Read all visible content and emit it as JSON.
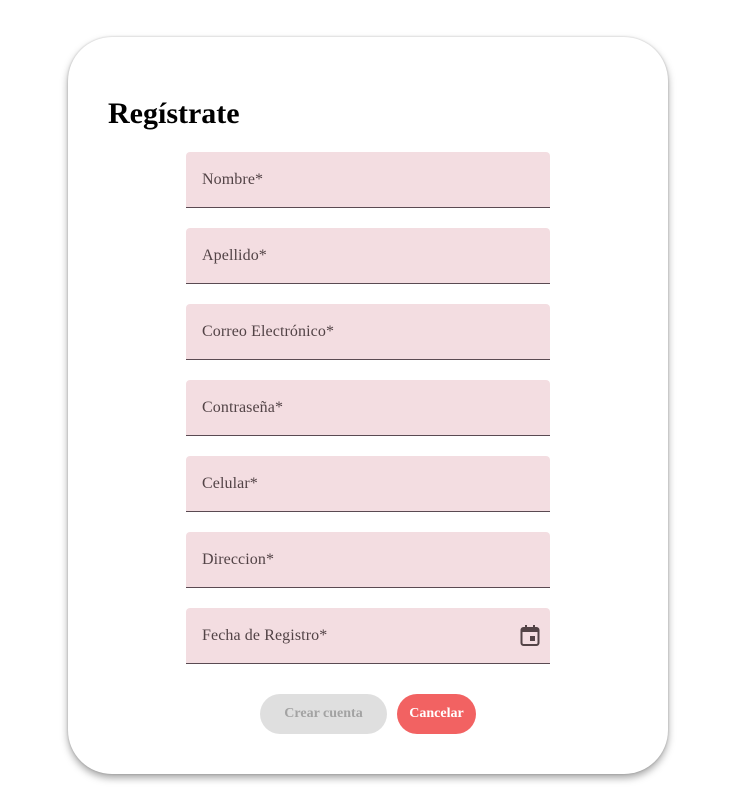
{
  "form": {
    "title": "Regístrate",
    "fields": [
      {
        "label": "Nombre*",
        "value": ""
      },
      {
        "label": "Apellido*",
        "value": ""
      },
      {
        "label": "Correo Electrónico*",
        "value": ""
      },
      {
        "label": "Contraseña*",
        "value": ""
      },
      {
        "label": "Celular*",
        "value": ""
      },
      {
        "label": "Direccion*",
        "value": ""
      },
      {
        "label": "Fecha de Registro*",
        "value": "",
        "icon": "calendar-icon"
      }
    ],
    "buttons": {
      "create_label": "Crear cuenta",
      "cancel_label": "Cancelar"
    }
  },
  "colors": {
    "field_background": "#f3dde1",
    "field_underline": "#5a4a52",
    "label_text": "#524346",
    "create_button_bg": "#dfdfdf",
    "create_button_text": "#a3a3a3",
    "cancel_button_bg": "#f26262",
    "cancel_button_text": "#ffffff"
  }
}
